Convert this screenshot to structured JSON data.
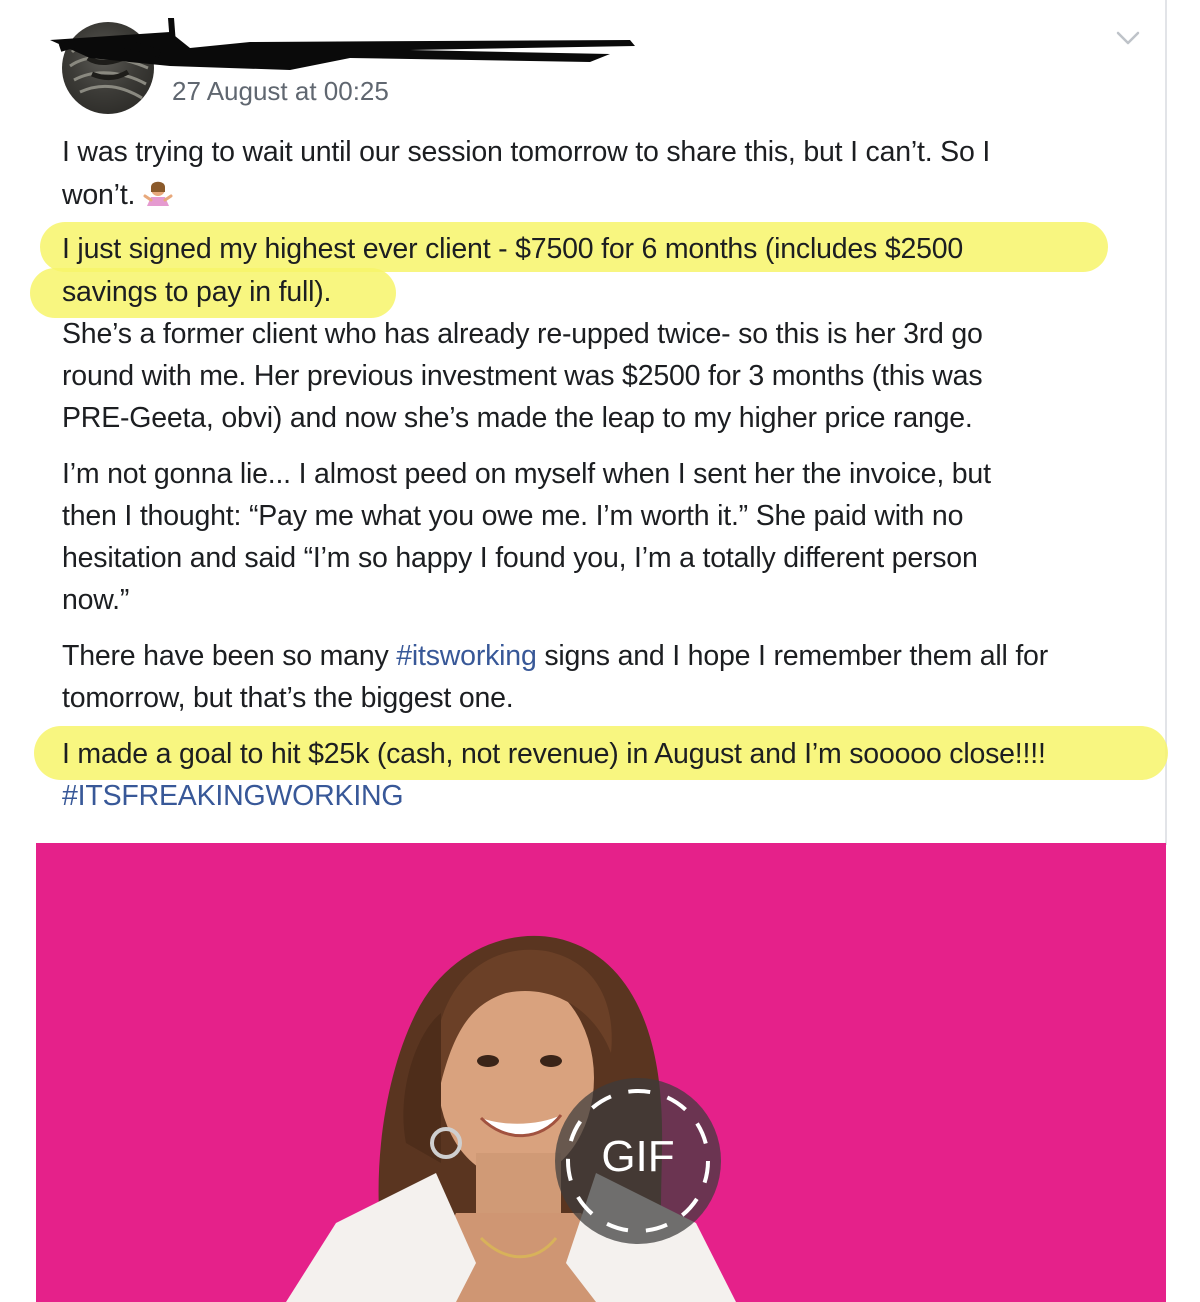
{
  "post": {
    "timestamp": "27 August at 00:25",
    "lines": [
      "I was trying to wait until our session tomorrow to share this, but I can’t. So I",
      "won’t.",
      "I just signed my highest ever client - $7500 for 6 months (includes $2500",
      "savings to pay in full).",
      "She’s a former client who has already re-upped twice- so this is her 3rd go",
      "round with me. Her previous investment was $2500 for 3 months (this was",
      "PRE-Geeta, obvi) and now she’s made the leap to my higher price range.",
      "I’m not gonna lie... I almost peed on myself when I sent her the invoice, but",
      "then I thought: “Pay me what you owe me. I’m worth it.” She paid with no",
      "hesitation and said “I’m so happy I found you, I’m a totally different person",
      "now.”",
      "I made a goal to hit $25k (cash, not revenue) in August and I’m sooooo close!!!!"
    ],
    "line10_before": "There have been so many ",
    "line10_hashtag": "#itsworking",
    "line10_after": " signs and I hope I remember them all for",
    "line11": "tomorrow, but that’s the biggest one.",
    "hashtag_final": "#ITSFREAKINGWORKING",
    "emoji_icon": "person-shrugging-emoji",
    "highlight_color": "#f7f56a",
    "hashtag_color": "#385898"
  },
  "media": {
    "background_color": "#e5218a",
    "badge_label": "GIF"
  }
}
